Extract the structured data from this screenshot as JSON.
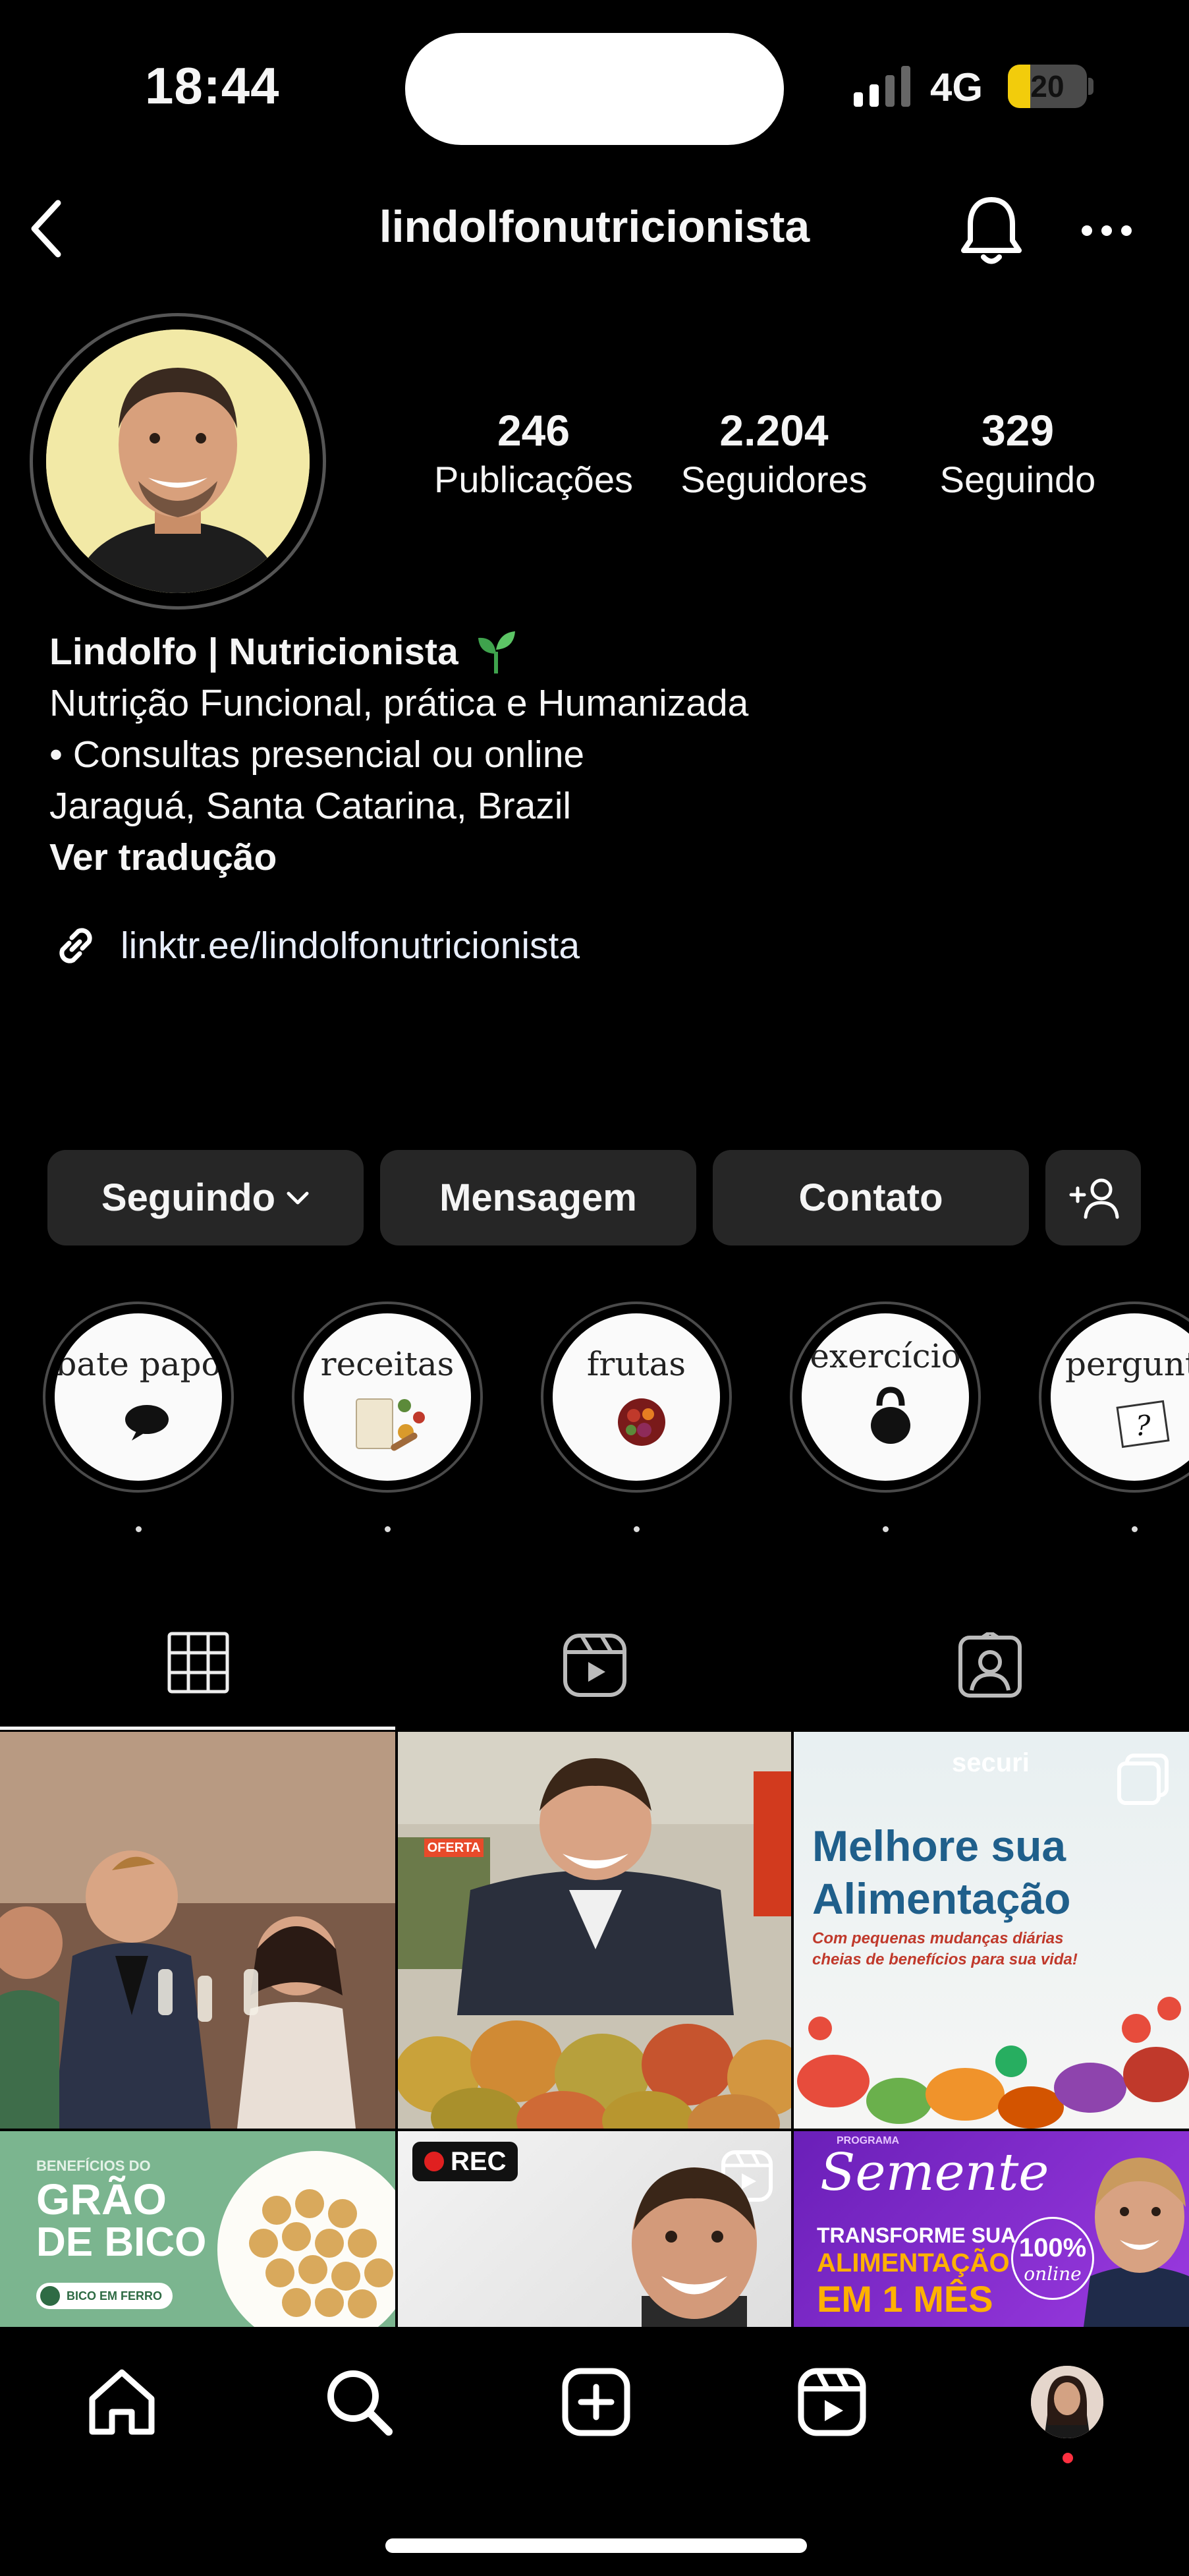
{
  "status_bar": {
    "time": "18:44",
    "network": "4G",
    "battery": "20"
  },
  "header": {
    "username": "lindolfonutricionista"
  },
  "profile": {
    "stats": [
      {
        "value": "246",
        "label": "Publicações"
      },
      {
        "value": "2.204",
        "label": "Seguidores"
      },
      {
        "value": "329",
        "label": "Seguindo"
      }
    ],
    "display_name": "Lindolfo | Nutricionista",
    "bio_lines": [
      "Nutrição Funcional, prática e Humanizada",
      "• Consultas presencial ou online",
      "Jaraguá, Santa Catarina, Brazil"
    ],
    "translate": "Ver tradução",
    "link": "linktr.ee/lindolfonutricionista"
  },
  "actions": {
    "following": "Seguindo",
    "message": "Mensagem",
    "contact": "Contato"
  },
  "highlights": [
    {
      "label": "bate papo"
    },
    {
      "label": "receitas"
    },
    {
      "label": "frutas"
    },
    {
      "label": "exercício"
    },
    {
      "label": "pergunta"
    }
  ],
  "posts": {
    "p3": {
      "brand": "securi",
      "title1": "Melhore sua",
      "title2": "Alimentação",
      "subtitle1": "Com pequenas mudanças diárias",
      "subtitle2": "cheias de benefícios para sua vida!"
    },
    "p4": {
      "kicker": "BENEFÍCIOS DO",
      "title1": "GRÃO",
      "title2": "DE BICO",
      "tag": "BICO EM FERRO"
    },
    "p5": {
      "badge": "REC"
    },
    "p6": {
      "kicker": "PROGRAMA",
      "title": "Semente",
      "line1": "TRANSFORME SUA",
      "line2": "ALIMENTAÇÃO",
      "line3": "EM 1 MÊS",
      "seal1": "100%",
      "seal2": "online"
    },
    "p2": {
      "sign": "OFERTA"
    }
  },
  "colors": {
    "background": "#000000",
    "button": "#262626",
    "accent_blue": "#1f5f8b",
    "accent_purple": "#7a2ecf",
    "notification": "#ff3040"
  }
}
